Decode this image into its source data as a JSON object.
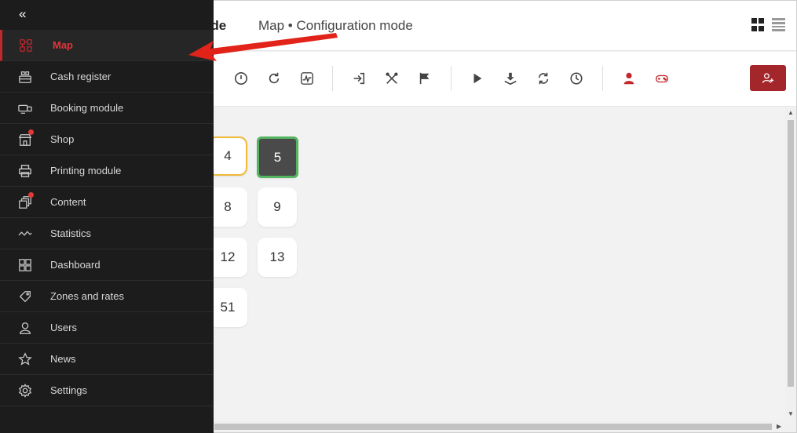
{
  "header": {
    "title_partial": "ode",
    "breadcrumb": "Map • Configuration mode"
  },
  "sidebar": {
    "collapse_glyph": "«",
    "items": [
      {
        "label": "Map",
        "icon": "map-icon",
        "active": true
      },
      {
        "label": "Cash register",
        "icon": "cash-register-icon"
      },
      {
        "label": "Booking module",
        "icon": "booking-icon"
      },
      {
        "label": "Shop",
        "icon": "shop-icon",
        "notification": true
      },
      {
        "label": "Printing module",
        "icon": "printer-icon"
      },
      {
        "label": "Content",
        "icon": "content-icon",
        "notification": true
      },
      {
        "label": "Statistics",
        "icon": "statistics-icon"
      },
      {
        "label": "Dashboard",
        "icon": "dashboard-icon"
      },
      {
        "label": "Zones and rates",
        "icon": "zones-icon"
      },
      {
        "label": "Users",
        "icon": "users-icon"
      },
      {
        "label": "News",
        "icon": "star-icon"
      },
      {
        "label": "Settings",
        "icon": "gear-icon"
      }
    ]
  },
  "tiles": [
    "4",
    "5",
    "8",
    "9",
    "12",
    "13",
    "51"
  ],
  "colors": {
    "accent": "#c2272c",
    "sidebar_bg": "#1c1c1c",
    "selected_border": "#54b560",
    "highlight_border": "#f0b93a",
    "button": "#a3262a"
  }
}
